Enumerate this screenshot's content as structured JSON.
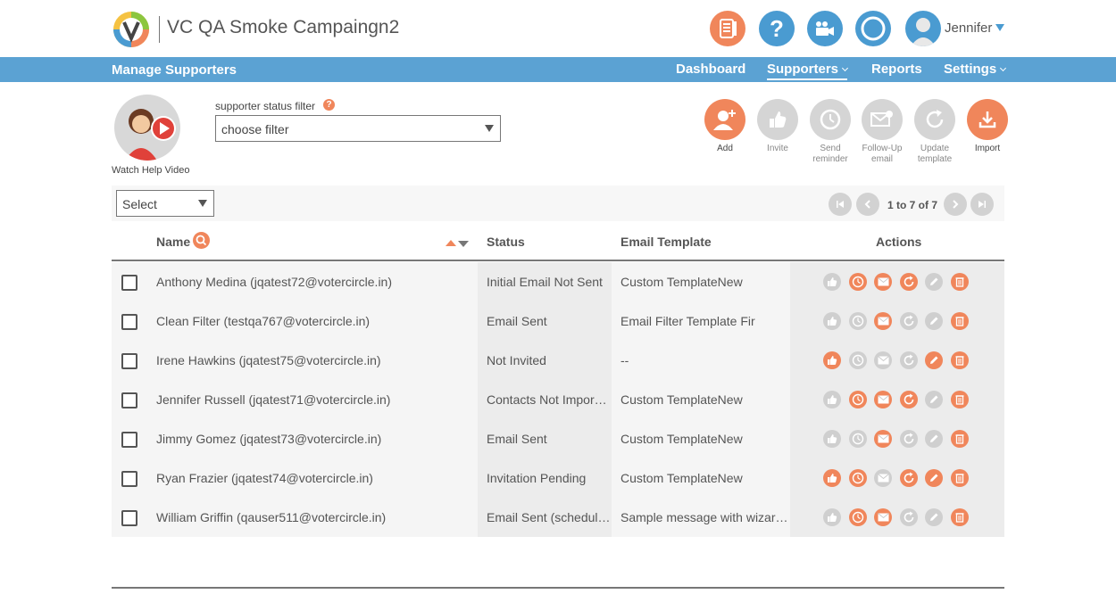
{
  "header": {
    "app_title": "VC QA Smoke Campaingn2",
    "user_name": "Jennifer",
    "icons": [
      "checklist-icon",
      "help-icon",
      "video-camera-icon",
      "ring-icon"
    ]
  },
  "nav": {
    "section_title": "Manage Supporters",
    "items": [
      {
        "label": "Dashboard",
        "dropdown": false,
        "active": false
      },
      {
        "label": "Supporters",
        "dropdown": true,
        "active": true
      },
      {
        "label": "Reports",
        "dropdown": false,
        "active": false
      },
      {
        "label": "Settings",
        "dropdown": true,
        "active": false
      }
    ]
  },
  "help": {
    "label": "Watch Help Video"
  },
  "filter": {
    "label": "supporter status filter",
    "selected": "choose filter"
  },
  "actions": [
    {
      "label": "Add",
      "icon": "add-user-icon",
      "enabled": true
    },
    {
      "label": "Invite",
      "icon": "thumbs-up-icon",
      "enabled": false
    },
    {
      "label": "Send reminder",
      "icon": "clock-icon",
      "enabled": false
    },
    {
      "label": "Follow-Up email",
      "icon": "email-icon",
      "enabled": false
    },
    {
      "label": "Update template",
      "icon": "refresh-icon",
      "enabled": false
    },
    {
      "label": "Import",
      "icon": "import-icon",
      "enabled": true
    }
  ],
  "bulk": {
    "selected": "Select"
  },
  "pager": {
    "text": "1 to 7 of 7"
  },
  "table": {
    "columns": {
      "name": "Name",
      "status": "Status",
      "template": "Email Template",
      "actions": "Actions"
    },
    "rows": [
      {
        "name": "Anthony Medina (jqatest72@votercircle.in)",
        "status": "Initial Email Not Sent",
        "template": "Custom TemplateNew",
        "icons": [
          0,
          1,
          1,
          1,
          0,
          1
        ]
      },
      {
        "name": "Clean Filter (testqa767@votercircle.in)",
        "status": "Email Sent",
        "template": "Email Filter Template Fir",
        "icons": [
          0,
          0,
          1,
          0,
          0,
          1
        ]
      },
      {
        "name": "Irene Hawkins (jqatest75@votercircle.in)",
        "status": "Not Invited",
        "template": "--",
        "icons": [
          1,
          0,
          0,
          0,
          1,
          1
        ]
      },
      {
        "name": "Jennifer Russell (jqatest71@votercircle.in)",
        "status": "Contacts Not Impor…",
        "template": "Custom TemplateNew",
        "icons": [
          0,
          1,
          1,
          1,
          0,
          1
        ]
      },
      {
        "name": "Jimmy Gomez (jqatest73@votercircle.in)",
        "status": "Email Sent",
        "template": "Custom TemplateNew",
        "icons": [
          0,
          0,
          1,
          0,
          0,
          1
        ]
      },
      {
        "name": "Ryan Frazier (jqatest74@votercircle.in)",
        "status": "Invitation Pending",
        "template": "Custom TemplateNew",
        "icons": [
          1,
          1,
          0,
          1,
          1,
          1
        ]
      },
      {
        "name": "William Griffin (qauser511@votercircle.in)",
        "status": "Email Sent (schedul…",
        "template": "Sample message with wizar…",
        "icons": [
          0,
          1,
          1,
          0,
          0,
          1
        ]
      }
    ]
  },
  "colors": {
    "accent": "#f0865b",
    "brand_blue": "#5ba2d3",
    "disabled": "#cfcfcf"
  }
}
